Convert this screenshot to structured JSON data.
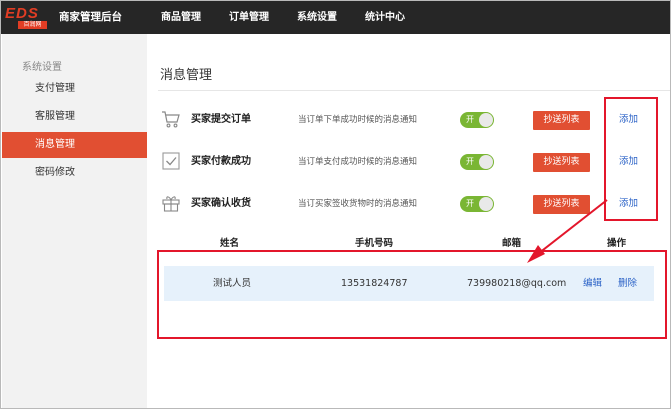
{
  "header": {
    "logo_text": "EDS",
    "logo_sub": "百润网",
    "app_title": "商家管理后台",
    "nav": [
      "商品管理",
      "订单管理",
      "系统设置",
      "统计中心"
    ]
  },
  "sidebar": {
    "heading": "系统设置",
    "items": [
      {
        "label": "支付管理"
      },
      {
        "label": "客服管理"
      },
      {
        "label": "消息管理"
      },
      {
        "label": "密码修改"
      }
    ]
  },
  "main": {
    "page_title": "消息管理",
    "notices": [
      {
        "icon": "cart-icon",
        "title": "买家提交订单",
        "desc": "当订单下单成功时候的消息通知",
        "toggle": "开",
        "cc_label": "抄送列表",
        "add_label": "添加"
      },
      {
        "icon": "check-icon",
        "title": "买家付款成功",
        "desc": "当订单支付成功时候的消息通知",
        "toggle": "开",
        "cc_label": "抄送列表",
        "add_label": "添加"
      },
      {
        "icon": "gift-icon",
        "title": "买家确认收货",
        "desc": "当订买家签收货物时的消息通知",
        "toggle": "开",
        "cc_label": "抄送列表",
        "add_label": "添加"
      }
    ],
    "list": {
      "columns": [
        "姓名",
        "手机号码",
        "邮箱",
        "操作"
      ],
      "rows": [
        {
          "name": "测试人员",
          "phone": "13531824787",
          "email": "739980218@qq.com",
          "edit": "编辑",
          "delete": "删除"
        }
      ]
    }
  },
  "colors": {
    "topbar": "#262626",
    "accent": "#e14f32",
    "toggle_on": "#7ab634",
    "link": "#2c63c7",
    "annotation": "#e3162b"
  }
}
